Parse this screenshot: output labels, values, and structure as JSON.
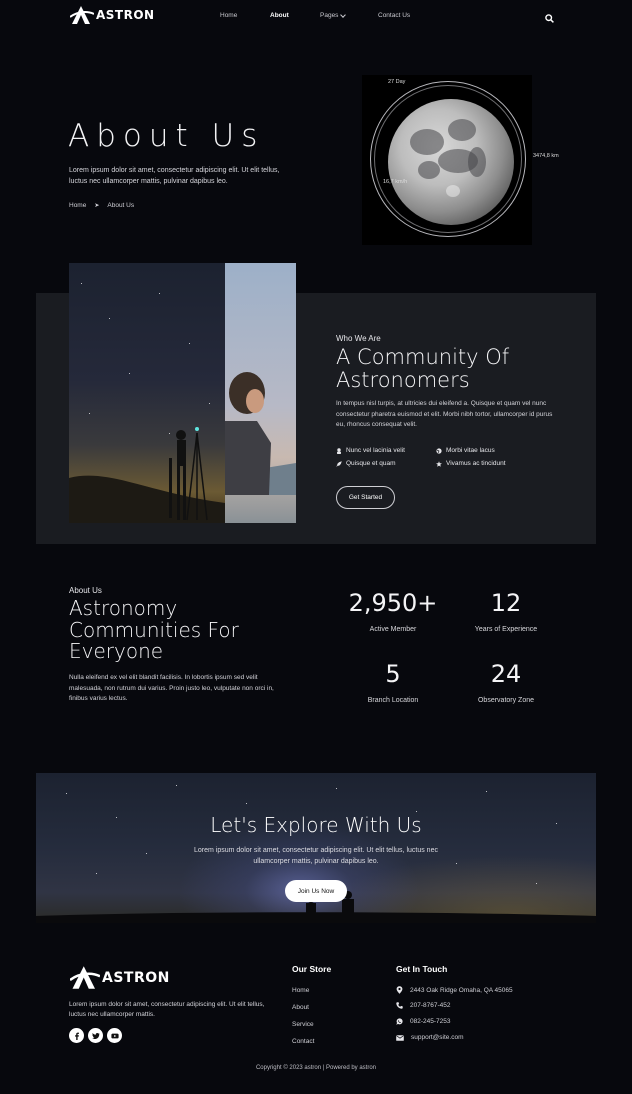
{
  "header": {
    "brand": "ASTRON",
    "nav": [
      {
        "label": "Home"
      },
      {
        "label": "About"
      },
      {
        "label": "Pages"
      },
      {
        "label": "Contact Us"
      }
    ],
    "search_icon": "search-icon"
  },
  "hero": {
    "title": "About Us",
    "text": "Lorem ipsum dolor sit amet, consectetur adipiscing elit. Ut elit tellus, luctus nec ullamcorper mattis, pulvinar dapibus leo.",
    "breadcrumb": {
      "home": "Home",
      "separator": "➤",
      "current": "About Us"
    },
    "moon": {
      "day": "27 Day",
      "diameter": "3474,8 km",
      "speed": "16,7 km/h"
    }
  },
  "who": {
    "eyebrow": "Who We Are",
    "title_line1": "A Community Of",
    "title_line2": "Astronomers",
    "text": "In tempus nisl turpis, at ultricies dui eleifend a. Quisque et quam vel nunc consectetur pharetra euismod et elit. Morbi nibh tortor, ullamcorper id purus eu, rhoncus consequat velit.",
    "features": [
      {
        "label": "Nunc vel lacinia velit",
        "icon": "astronaut-icon"
      },
      {
        "label": "Morbi vitae lacus",
        "icon": "globe-icon"
      },
      {
        "label": "Quisque et quam",
        "icon": "rocket-icon"
      },
      {
        "label": "Vivamus ac tincidunt",
        "icon": "star-icon"
      }
    ],
    "button": "Get Started"
  },
  "stats_section": {
    "eyebrow": "About Us",
    "title_line1": "Astronomy",
    "title_line2": "Communities For",
    "title_line3": "Everyone",
    "text": "Nulla eleifend ex vel elit blandit facilisis. In lobortis ipsum sed velit malesuada, non rutrum dui varius. Proin justo leo, vulputate non orci in, finibus varius lectus.",
    "stats": [
      {
        "value": "2,950+",
        "label": "Active Member"
      },
      {
        "value": "12",
        "label": "Years of Experience"
      },
      {
        "value": "5",
        "label": "Branch Location"
      },
      {
        "value": "24",
        "label": "Observatory Zone"
      }
    ]
  },
  "explore": {
    "title": "Let's Explore With Us",
    "text_line1": "Lorem ipsum dolor sit amet, consectetur adipiscing elit. Ut elit tellus, luctus nec",
    "text_line2": "ullamcorper mattis, pulvinar dapibus leo.",
    "button": "Join Us Now"
  },
  "footer": {
    "brand": "ASTRON",
    "text": "Lorem ipsum dolor sit amet, consectetur adipiscing elit. Ut elit tellus, luctus nec ullamcorper mattis.",
    "social": [
      "facebook-icon",
      "twitter-icon",
      "youtube-icon"
    ],
    "store_heading": "Our Store",
    "store_links": [
      "Home",
      "About",
      "Service",
      "Contact"
    ],
    "contact_heading": "Get In Touch",
    "contacts": [
      {
        "icon": "location-pin-icon",
        "text": "2443 Oak Ridge Omaha, QA 45065"
      },
      {
        "icon": "phone-icon",
        "text": "207-8767-452"
      },
      {
        "icon": "whatsapp-icon",
        "text": "082-245-7253"
      },
      {
        "icon": "envelope-icon",
        "text": "support@site.com"
      }
    ],
    "copyright": "Copyright © 2023 astron | Powered by astron"
  }
}
